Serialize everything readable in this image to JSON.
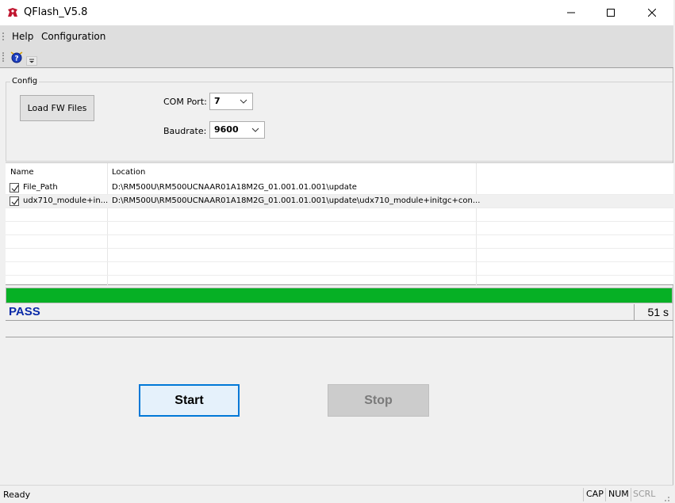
{
  "window": {
    "title": "QFlash_V5.8"
  },
  "menu": {
    "help": "Help",
    "configuration": "Configuration"
  },
  "toolbar": {
    "help_icon": "help-question-icon",
    "overflow_icon": "chevron-down-icon"
  },
  "config": {
    "legend": "Config",
    "load_button": "Load FW Files",
    "com_port_label": "COM Port:",
    "com_port_value": "7",
    "baudrate_label": "Baudrate:",
    "baudrate_value": "9600"
  },
  "files": {
    "columns": [
      "Name",
      "Location"
    ],
    "rows": [
      {
        "checked": true,
        "name": "File_Path",
        "location": "D:\\RM500U\\RM500UCNAAR01A18M2G_01.001.01.001\\update"
      },
      {
        "checked": true,
        "name": "udx710_module+in...",
        "location": "D:\\RM500U\\RM500UCNAAR01A18M2G_01.001.01.001\\update\\udx710_module+initgc+con..."
      }
    ]
  },
  "progress": {
    "percent": 100,
    "color": "#06b025"
  },
  "status": {
    "result": "PASS",
    "elapsed": "51 s",
    "message": ""
  },
  "actions": {
    "start": "Start",
    "stop": "Stop"
  },
  "statusbar": {
    "ready": "Ready",
    "cap": "CAP",
    "num": "NUM",
    "scrl": "SCRL"
  },
  "colors": {
    "pass_text": "#0a2aa8",
    "accent": "#0078d7"
  }
}
